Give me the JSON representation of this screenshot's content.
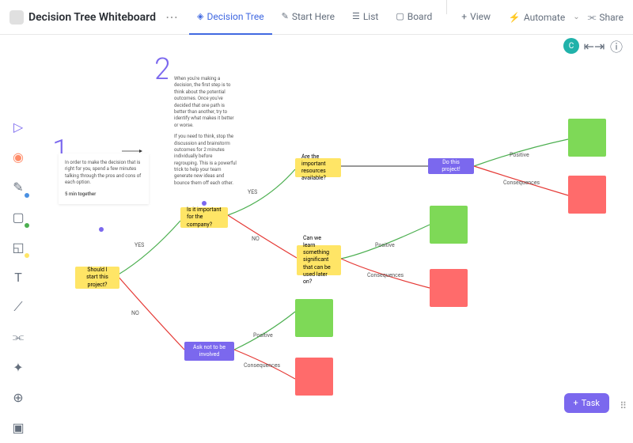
{
  "header": {
    "title": "Decision Tree Whiteboard",
    "tabs": [
      {
        "label": "Decision Tree",
        "ic": "◈"
      },
      {
        "label": "Start Here",
        "ic": "✎"
      },
      {
        "label": "List",
        "ic": "☰"
      },
      {
        "label": "Board",
        "ic": "▢"
      }
    ],
    "view": "View",
    "automate": "Automate",
    "share": "Share",
    "avatar": "C"
  },
  "notes": {
    "n1_num": "1",
    "n1_text": "In order to make the decision that is right for you, spend a few minutes talking through the pros and cons of each option.",
    "n1_foot": "5 min together",
    "n2_num": "2",
    "n2_text": "When you're making a decision, the first step is to think about the potential outcomes. Once you've decided that one path is better than another, try to identify what makes it better or worse.",
    "n2_text2": "If you need to think, stop the discussion and brainstorm outcomes for 2 minutes individually before regrouping. This is a powerful trick to help your team generate new ideas and bounce them off each other."
  },
  "nodes": {
    "start": "Should I start this project?",
    "important": "Is it important for the company?",
    "resources": "Are the important resources available?",
    "learn": "Can we learn something significant that can be used later on?",
    "doproject": "Do this project!",
    "notinvolved": "Ask not to be involved"
  },
  "labels": {
    "yes": "YES",
    "no": "NO",
    "positive": "Positive",
    "consequences": "Consequences"
  },
  "task": "Task"
}
